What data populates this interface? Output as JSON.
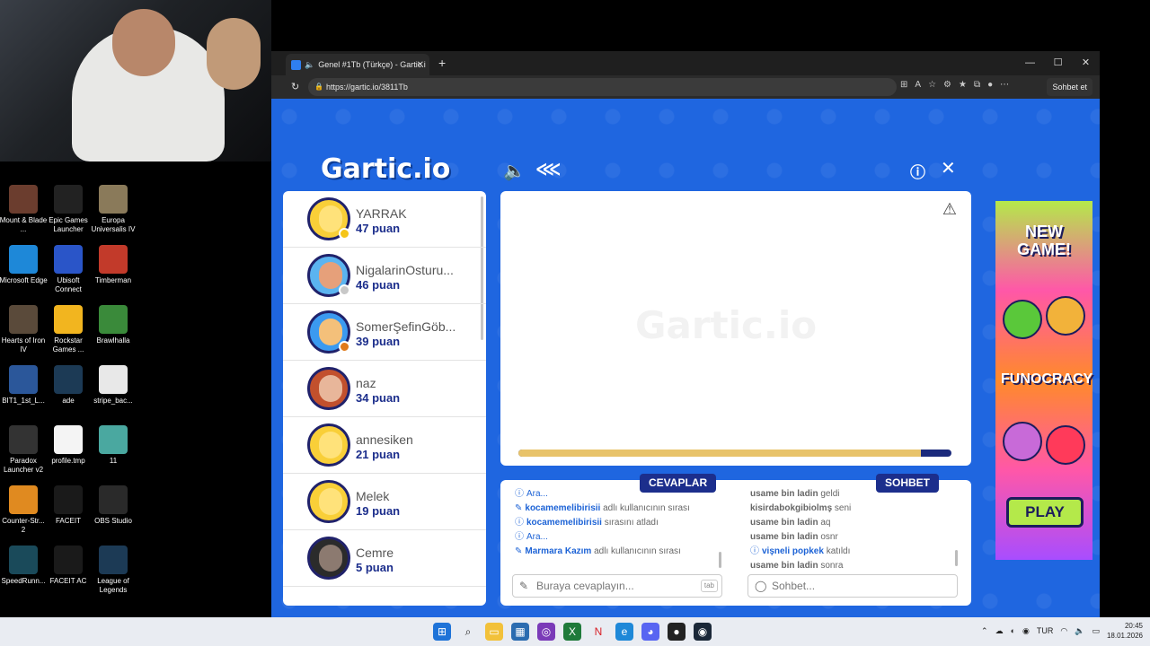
{
  "desktop_icons": [
    {
      "label": "Mount & Blade ...",
      "color": "#6b3d2e",
      "icon": "mount-blade-icon"
    },
    {
      "label": "Epic Games Launcher",
      "color": "#222222",
      "icon": "epic-games-icon"
    },
    {
      "label": "Europa Universalis IV",
      "color": "#8a7a5a",
      "icon": "europa-icon"
    },
    {
      "label": "Microsoft Edge",
      "color": "#1e88d8",
      "icon": "edge-icon"
    },
    {
      "label": "Ubisoft Connect",
      "color": "#2a55c8",
      "icon": "ubisoft-icon"
    },
    {
      "label": "Timberman",
      "color": "#c23a2a",
      "icon": "timberman-icon"
    },
    {
      "label": "Hearts of Iron IV",
      "color": "#5a4a3a",
      "icon": "hoi-icon"
    },
    {
      "label": "Rockstar Games ...",
      "color": "#f2b51f",
      "icon": "rockstar-icon"
    },
    {
      "label": "Brawlhalla",
      "color": "#3a8a3a",
      "icon": "brawlhalla-icon"
    },
    {
      "label": "BIT1_1st_L...",
      "color": "#2b579a",
      "icon": "word-icon"
    },
    {
      "label": "ade",
      "color": "#1c3a55",
      "icon": "lol-icon"
    },
    {
      "label": "stripe_bac...",
      "color": "#e8e8e8",
      "icon": "file-icon"
    },
    {
      "label": "Paradox Launcher v2",
      "color": "#333333",
      "icon": "paradox-icon"
    },
    {
      "label": "profile.tmp",
      "color": "#f4f4f4",
      "icon": "file-icon"
    },
    {
      "label": "11",
      "color": "#4aa8a0",
      "icon": "image-icon"
    },
    {
      "label": "Counter-Str... 2",
      "color": "#e08a20",
      "icon": "cs2-icon"
    },
    {
      "label": "FACEIT",
      "color": "#1a1a1a",
      "icon": "faceit-icon"
    },
    {
      "label": "OBS Studio",
      "color": "#2a2a2a",
      "icon": "obs-icon"
    },
    {
      "label": "SpeedRunn...",
      "color": "#1a4a5a",
      "icon": "speedrunners-icon"
    },
    {
      "label": "FACEIT AC",
      "color": "#1a1a1a",
      "icon": "faceit-ac-icon"
    },
    {
      "label": "League of Legends",
      "color": "#1c3a55",
      "icon": "lol-icon"
    }
  ],
  "browser": {
    "tab_title": "Genel #1Tb (Türkçe) - Gartic.i",
    "url": "https://gartic.io/3811Tb",
    "copilot_label": "Sohbet et"
  },
  "game": {
    "logo": "Gartic.io",
    "players": [
      {
        "name": "YARRAK",
        "score": "47 puan",
        "avatar": "c1",
        "status": "#f5c518"
      },
      {
        "name": "NigalarinOsturu...",
        "score": "46 puan",
        "avatar": "c2",
        "status": "#c8c8c8"
      },
      {
        "name": "SomerŞefinGöb...",
        "score": "39 puan",
        "avatar": "c3",
        "status": "#e07a1a"
      },
      {
        "name": "naz",
        "score": "34 puan",
        "avatar": "photo1",
        "status": ""
      },
      {
        "name": "annesiken",
        "score": "21 puan",
        "avatar": "c1",
        "status": ""
      },
      {
        "name": "Melek",
        "score": "19 puan",
        "avatar": "c1",
        "status": ""
      },
      {
        "name": "Cemre",
        "score": "5 puan",
        "avatar": "photo2",
        "status": ""
      }
    ],
    "canvas_watermark": "Gartic.io",
    "timer_progress": 0.93,
    "answers_label": "CEVAPLAR",
    "chat_label": "SOHBET",
    "answers": [
      {
        "icon": "info",
        "user": "",
        "text": "Ara..."
      },
      {
        "icon": "pencil",
        "user": "kocamemelibirisii",
        "text": "adlı kullanıcının sırası"
      },
      {
        "icon": "info",
        "user": "kocamemelibirisii",
        "text": "sırasını atladı"
      },
      {
        "icon": "info",
        "user": "",
        "text": "Ara..."
      },
      {
        "icon": "pencil",
        "user": "Marmara Kazım",
        "text": "adlı kullanıcının sırası"
      }
    ],
    "chat": [
      {
        "icon": "",
        "user": "usame bin ladin",
        "text": "geldi"
      },
      {
        "icon": "",
        "user": "kisirdabokgibiolmş",
        "text": "seni"
      },
      {
        "icon": "",
        "user": "usame bin ladin",
        "text": "aq"
      },
      {
        "icon": "",
        "user": "usame bin ladin",
        "text": "osnr"
      },
      {
        "icon": "info",
        "user": "vişneli popkek",
        "text": "katıldı"
      },
      {
        "icon": "",
        "user": "usame bin ladin",
        "text": "sonra"
      }
    ],
    "answer_placeholder": "Buraya cevaplayın...",
    "answer_hint": "tab",
    "chat_placeholder": "Sohbet..."
  },
  "ad": {
    "headline": "NEW GAME!",
    "brand": "FUNOCRACY",
    "cta": "PLAY"
  },
  "taskbar": {
    "language": "TUR",
    "time": "20:45",
    "date": "18.01.2026"
  }
}
